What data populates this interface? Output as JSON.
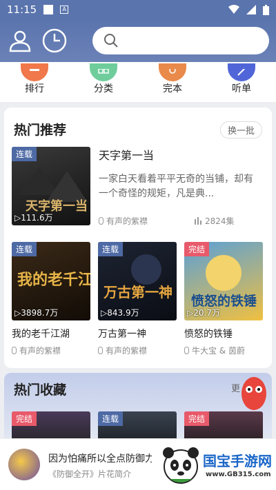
{
  "status": {
    "time": "11:15"
  },
  "categories": [
    {
      "label": "排行",
      "color": "#f0784a"
    },
    {
      "label": "分类",
      "color": "#6fcd9c"
    },
    {
      "label": "完本",
      "color": "#e98a4a"
    },
    {
      "label": "听单",
      "color": "#5066d8"
    }
  ],
  "hot": {
    "title": "热门推荐",
    "refresh": "换一批",
    "featured": {
      "badge": "连载",
      "plays": "▷111.6万",
      "title": "天字第一当",
      "desc": "一家白天看着平平无奇的当铺，却有一个奇怪的规矩，凡是典...",
      "author": "有声的紫襟",
      "episodes": "2824集"
    },
    "grid": [
      {
        "badge": "连载",
        "plays": "▷3898.7万",
        "title": "我的老千江湖",
        "author": "有声的紫襟",
        "cover_text": "我的老千江湖"
      },
      {
        "badge": "连载",
        "plays": "▷843.9万",
        "title": "万古第一神",
        "author": "有声的紫襟",
        "cover_text": "万古第一神"
      },
      {
        "badge": "完结",
        "plays": "▷20.7万",
        "title": "愤怒的铁锤",
        "author": "牛大宝 & 茵蔚",
        "cover_text": "愤怒的铁锤"
      }
    ]
  },
  "fav": {
    "title": "热门收藏",
    "more": "更",
    "badges": [
      "完结",
      "连载",
      "完结"
    ]
  },
  "player": {
    "title": "因为怕痛所以全点防御力了",
    "subtitle": "《防御全开》片花简介"
  },
  "watermark": {
    "name": "国宝手游网",
    "url": "www.GB315.com"
  }
}
